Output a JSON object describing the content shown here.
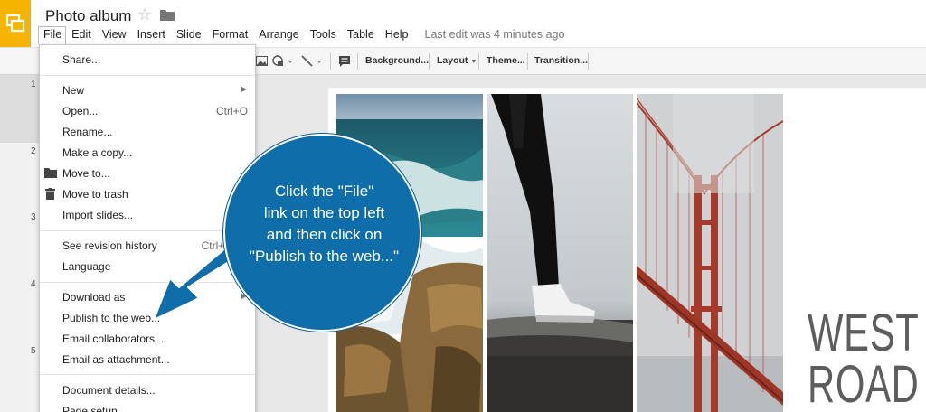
{
  "app": {
    "title": "Photo album",
    "last_edit": "Last edit was 4 minutes ago",
    "brand_color": "#f4b400"
  },
  "menubar": {
    "items": [
      "File",
      "Edit",
      "View",
      "Insert",
      "Slide",
      "Format",
      "Arrange",
      "Tools",
      "Table",
      "Help"
    ],
    "active": "File"
  },
  "toolbar": {
    "background": "Background...",
    "layout": "Layout",
    "theme": "Theme...",
    "transition": "Transition..."
  },
  "filmstrip": {
    "slide_numbers": [
      "1",
      "2",
      "3",
      "4",
      "5"
    ]
  },
  "file_menu": {
    "items": [
      {
        "label": "Share...",
        "shortcut": ""
      },
      {
        "label": "New",
        "shortcut": "",
        "submenu": true
      },
      {
        "label": "Open...",
        "shortcut": "Ctrl+O"
      },
      {
        "label": "Rename...",
        "shortcut": ""
      },
      {
        "label": "Make a copy...",
        "shortcut": ""
      },
      {
        "label": "Move to...",
        "shortcut": "",
        "icon": "folder-icon"
      },
      {
        "label": "Move to trash",
        "shortcut": "",
        "icon": "trash-icon"
      },
      {
        "label": "Import slides...",
        "shortcut": ""
      },
      {
        "label": "See revision history",
        "shortcut": "Ctrl+Alt+Sh"
      },
      {
        "label": "Language",
        "shortcut": ""
      },
      {
        "label": "Download as",
        "shortcut": "",
        "submenu": true
      },
      {
        "label": "Publish to the web...",
        "shortcut": ""
      },
      {
        "label": "Email collaborators...",
        "shortcut": ""
      },
      {
        "label": "Email as attachment...",
        "shortcut": ""
      },
      {
        "label": "Document details...",
        "shortcut": ""
      },
      {
        "label": "Page setup...",
        "shortcut": ""
      }
    ]
  },
  "callout": {
    "lines": [
      "Click the \"File\"",
      "link on the top left",
      "and then click on",
      "\"Publish to the web...\""
    ],
    "color": "#0f6da9"
  },
  "slide": {
    "text_line1": "WEST C",
    "text_line2": "ROAD T"
  }
}
